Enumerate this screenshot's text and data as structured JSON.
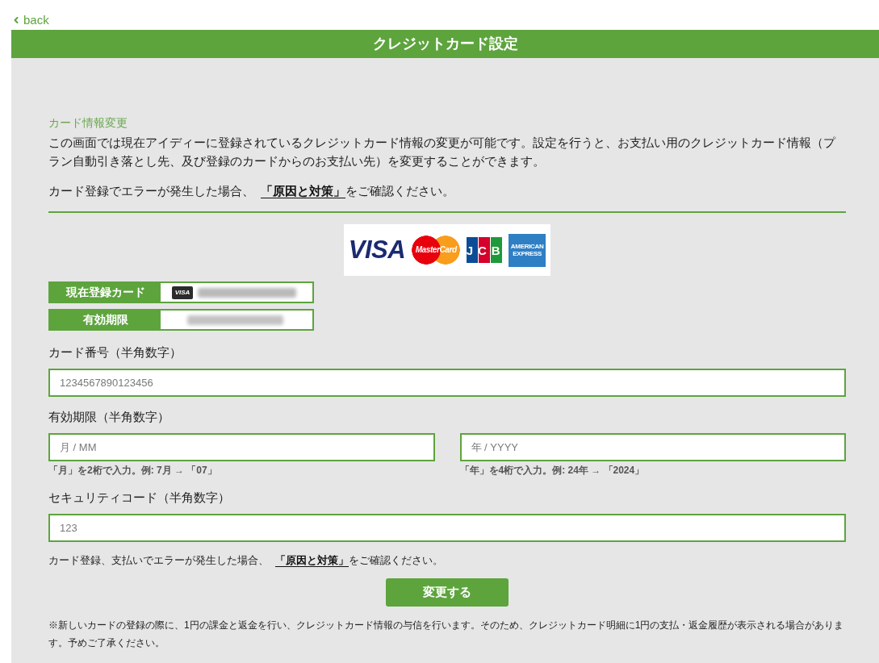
{
  "back_link": {
    "label": "back"
  },
  "header": {
    "title": "クレジットカード設定"
  },
  "section": {
    "heading": "カード情報変更",
    "description": "この画面では現在アイディーに登録されているクレジットカード情報の変更が可能です。設定を行うと、お支払い用のクレジットカード情報（プラン自動引き落とし先、及び登録のカードからのお支払い先）を変更することができます。",
    "error_note": {
      "before": "カード登録でエラーが発生した場合、",
      "link": "「原因と対策」",
      "after": "をご確認ください。"
    }
  },
  "card_brands": [
    {
      "kind": "visa",
      "lines": [
        "VISA"
      ]
    },
    {
      "kind": "mastercard",
      "lines": [
        "MasterCard"
      ]
    },
    {
      "kind": "jcb",
      "lines": [
        "JCB"
      ]
    },
    {
      "kind": "amex",
      "lines": [
        "AMERICAN",
        "EXPRESS"
      ]
    }
  ],
  "registered_card": [
    {
      "kind": "card",
      "label": "現在登録カード",
      "badge": "VISA"
    },
    {
      "kind": "expiry",
      "label": "有効期限"
    }
  ],
  "fields": [
    {
      "label": "カード番号（半角数字）",
      "inputs": [
        {
          "placeholder": "1234567890123456"
        }
      ]
    },
    {
      "label": "有効期限（半角数字）",
      "inputs": [
        {
          "placeholder": "月 / MM",
          "hint": "「月」を2桁で入力。例: 7月 → 「07」"
        },
        {
          "placeholder": "年 / YYYY",
          "hint": "「年」を4桁で入力。例: 24年 → 「2024」"
        }
      ]
    },
    {
      "label": "セキュリティコード（半角数字）",
      "inputs": [
        {
          "placeholder": "123"
        }
      ]
    }
  ],
  "form_error_note": {
    "before": "カード登録、支払いでエラーが発生した場合、",
    "link": "「原因と対策」",
    "after": "をご確認ください。"
  },
  "submit_button": {
    "label": "変更する"
  },
  "notice": "※新しいカードの登録の際に、1円の課金と返金を行い、クレジットカード情報の与信を行います。そのため、クレジットカード明細に1円の支払・返金履歴が表示される場合があります。予めご了承ください。"
}
